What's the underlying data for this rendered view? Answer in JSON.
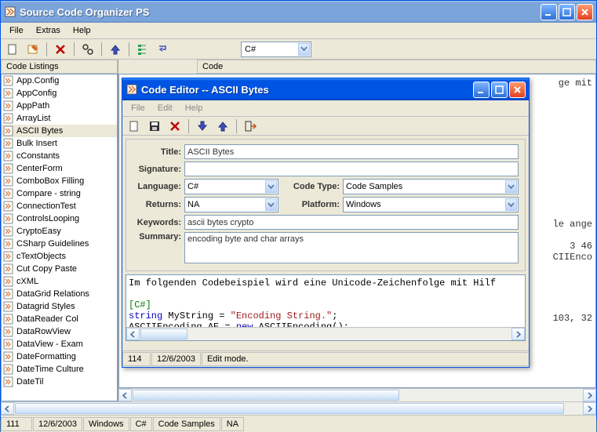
{
  "main": {
    "title": "Source Code Organizer PS",
    "menubar": [
      "File",
      "Extras",
      "Help"
    ],
    "toolbar": {
      "combo_value": "C#"
    },
    "sidebar_header": "Code Listings",
    "code_header": "Code",
    "tree_items": [
      "App.Config",
      "AppConfig",
      "AppPath",
      "ArrayList",
      "ASCII Bytes",
      "Bulk Insert",
      "cConstants",
      "CenterForm",
      "ComboBox Filling",
      "Compare - string",
      "ConnectionTest",
      "ControlsLooping",
      "CryptoEasy",
      "CSharp Guidelines",
      "cTextObjects",
      "Cut Copy Paste",
      "cXML",
      "DataGrid Relations",
      "Datagrid Styles",
      "DataReader Col",
      "DataRowView",
      "DataView - Exam",
      "DateFormatting",
      "DateTime Culture",
      "DateTil"
    ],
    "selected_index": 4,
    "code_fragments": {
      "top_right": "ge mit",
      "mid_right_1": "le ange",
      "mid_right_2": "3 46",
      "mid_right_3": "CIIEnco",
      "mid_right_4": "103, 32"
    },
    "statusbar": {
      "item1": "111",
      "item2": "12/6/2003",
      "item3": "Windows",
      "item4": "C#",
      "item5": "Code Samples",
      "item6": "NA"
    }
  },
  "editor": {
    "title": "Code Editor -- ASCII Bytes",
    "menubar": [
      "File",
      "Edit",
      "Help"
    ],
    "fields": {
      "title_label": "Title:",
      "title_value": "ASCII Bytes",
      "signature_label": "Signature:",
      "signature_value": "",
      "language_label": "Language:",
      "language_value": "C#",
      "codetype_label": "Code Type:",
      "codetype_value": "Code Samples",
      "returns_label": "Returns:",
      "returns_value": "NA",
      "platform_label": "Platform:",
      "platform_value": "Windows",
      "keywords_label": "Keywords:",
      "keywords_value": "ascii bytes crypto",
      "summary_label": "Summary:",
      "summary_value": "encoding byte and char arrays"
    },
    "code_lines": [
      {
        "text": "Im folgenden Codebeispiel wird eine Unicode-Zeichenfolge mit Hilf",
        "cls": ""
      },
      {
        "text": "",
        "cls": ""
      },
      {
        "text": "[C#]",
        "cls": "kw-green"
      },
      {
        "text_parts": [
          {
            "t": "string",
            "c": "kw-blue"
          },
          {
            "t": " MyString = ",
            "c": ""
          },
          {
            "t": "\"Encoding String.\"",
            "c": "kw-red"
          },
          {
            "t": ";",
            "c": ""
          }
        ]
      },
      {
        "text_parts": [
          {
            "t": "ASCIIEncoding AE = ",
            "c": ""
          },
          {
            "t": "new",
            "c": "kw-blue"
          },
          {
            "t": " ASCIIEncoding();",
            "c": ""
          }
        ]
      }
    ],
    "statusbar": {
      "item1": "114",
      "item2": "12/6/2003",
      "item3": "Edit mode."
    }
  }
}
